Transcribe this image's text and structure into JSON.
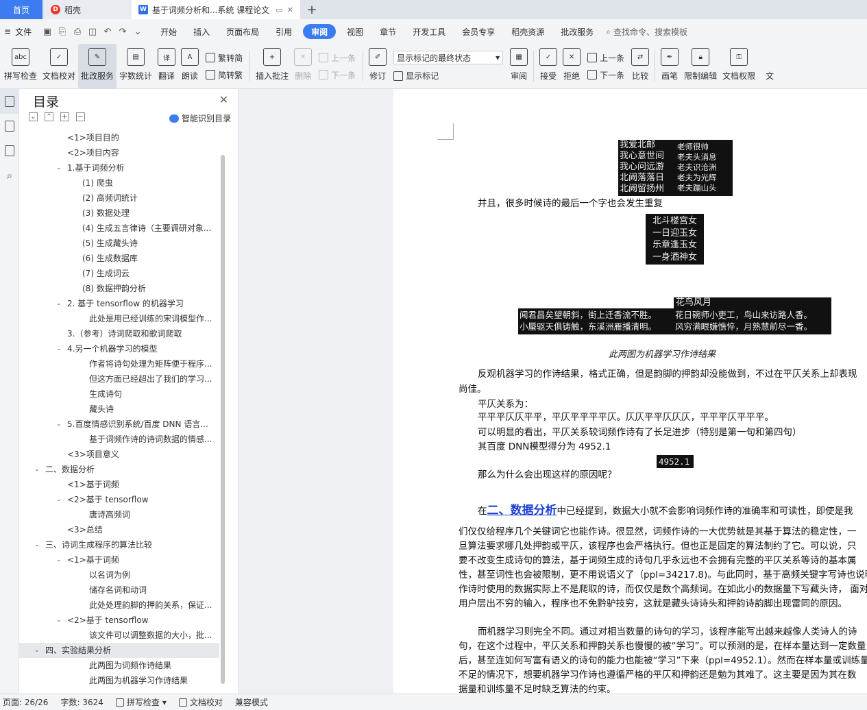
{
  "tabs": {
    "home": "首页",
    "docer": "稻壳",
    "doc": "基于词频分析和...系统 课程论文",
    "add": "+"
  },
  "menu": {
    "file": "文件",
    "tabs": [
      "开始",
      "插入",
      "页面布局",
      "引用",
      "审阅",
      "视图",
      "章节",
      "开发工具",
      "会员专享",
      "稻壳资源",
      "批改服务"
    ],
    "active_tab": "审阅",
    "search": "查找命令、搜索模板"
  },
  "ribbon": {
    "spell_check": "拼写检查",
    "doc_proof": "文档校对",
    "correction": "批改服务",
    "word_count": "字数统计",
    "translate": "翻译",
    "read_aloud": "朗读",
    "trad_to_simp": "繁转简",
    "simp_to_trad": "简转繁",
    "insert_comment": "插入批注",
    "delete": "删除",
    "prev_comment": "上一条",
    "next_comment": "下一条",
    "track": "修订",
    "markup_state": "显示标记的最终状态",
    "show_markup": "显示标记",
    "review": "审阅",
    "accept": "接受",
    "reject": "拒绝",
    "prev_change": "上一条",
    "next_change": "下一条",
    "compare": "比较",
    "pen": "画笔",
    "restrict": "限制编辑",
    "doc_rights": "文档权限",
    "more": "文"
  },
  "toc": {
    "title": "目录",
    "ai_label": "智能识别目录",
    "items": [
      {
        "label": "<1>项目目的",
        "lvl": 2,
        "car": ""
      },
      {
        "label": "<2>项目内容",
        "lvl": 2,
        "car": ""
      },
      {
        "label": "1.基于词频分析",
        "lvl": 2,
        "car": "v"
      },
      {
        "label": "(1) 爬虫",
        "lvl": 3,
        "car": ""
      },
      {
        "label": "(2) 高频词统计",
        "lvl": 3,
        "car": ""
      },
      {
        "label": "(3) 数据处理",
        "lvl": 3,
        "car": ""
      },
      {
        "label": "(4) 生成五言律诗（主要调研对象...",
        "lvl": 3,
        "car": ""
      },
      {
        "label": "(5) 生成藏头诗",
        "lvl": 3,
        "car": ""
      },
      {
        "label": "(6) 生成数据库",
        "lvl": 3,
        "car": ""
      },
      {
        "label": "(7) 生成词云",
        "lvl": 3,
        "car": ""
      },
      {
        "label": "(8) 数据押韵分析",
        "lvl": 3,
        "car": ""
      },
      {
        "label": "2. 基于 tensorflow 的机器学习",
        "lvl": 2,
        "car": "v"
      },
      {
        "label": "此处是用已经训练的宋词模型作...",
        "lvl": 4,
        "car": ""
      },
      {
        "label": "3.（参考）诗词爬取和歌词爬取",
        "lvl": 2,
        "car": ""
      },
      {
        "label": "4.另一个机器学习的模型",
        "lvl": 2,
        "car": "v"
      },
      {
        "label": "作者将诗句处理为矩阵便于程序...",
        "lvl": 4,
        "car": ""
      },
      {
        "label": "但这方面已经超出了我们的学习...",
        "lvl": 4,
        "car": ""
      },
      {
        "label": "生成诗句",
        "lvl": 4,
        "car": ""
      },
      {
        "label": "藏头诗",
        "lvl": 4,
        "car": ""
      },
      {
        "label": "5.百度情感识别系统/百度 DNN 语言...",
        "lvl": 2,
        "car": "v"
      },
      {
        "label": "基于词频作诗的诗词数据的情感...",
        "lvl": 4,
        "car": ""
      },
      {
        "label": "<3>项目意义",
        "lvl": 2,
        "car": ""
      },
      {
        "label": "二、数据分析",
        "lvl": 1,
        "car": "v"
      },
      {
        "label": "<1>基于词频",
        "lvl": 2,
        "car": ""
      },
      {
        "label": "<2>基于 tensorflow",
        "lvl": 2,
        "car": "v"
      },
      {
        "label": "唐诗高频词",
        "lvl": 4,
        "car": ""
      },
      {
        "label": "<3>总结",
        "lvl": 2,
        "car": ""
      },
      {
        "label": "三、诗词生成程序的算法比较",
        "lvl": 1,
        "car": "v"
      },
      {
        "label": "<1>基于词频",
        "lvl": 2,
        "car": "v"
      },
      {
        "label": "以名词为例",
        "lvl": 4,
        "car": ""
      },
      {
        "label": "储存名词和动词",
        "lvl": 4,
        "car": ""
      },
      {
        "label": "此处处理韵脚的押韵关系，保证...",
        "lvl": 4,
        "car": ""
      },
      {
        "label": "<2>基于 tensorflow",
        "lvl": 2,
        "car": "v"
      },
      {
        "label": "该文件可以调整数据的大小，批...",
        "lvl": 4,
        "car": ""
      },
      {
        "label": "四、实验结果分析",
        "lvl": 1,
        "car": "v",
        "selected": true
      },
      {
        "label": "此两图为词频作诗结果",
        "lvl": 4,
        "car": ""
      },
      {
        "label": "此两图为机器学习作诗结果",
        "lvl": 4,
        "car": ""
      }
    ]
  },
  "page": {
    "poem1_left": [
      "我爱北邮",
      "我心意世间",
      "我心问远游",
      "北阙落落日",
      "北阙留扬州"
    ],
    "poem1_right": [
      "老师很帅",
      "老夫头消息",
      "老夫识沧洲",
      "老夫为光辉",
      "老夫蹦山头"
    ],
    "repeat_note": "并且，很多时候诗的最后一个字也会发生重复",
    "poem2": [
      "北斗楼宫女",
      "一日迎玉女",
      "乐章逢玉女",
      "一身酒神女"
    ],
    "poem3_title": "花鸟风月",
    "poem3_left": [
      "闻君昌矣望朝斜，街上迁香流不胜。",
      "小蜃驱天俱铸触，东溪洲雁播清明。"
    ],
    "poem3_right": [
      "花日碗师小吏工，鸟山来访路人香。",
      "风穷满眼嫌憔悴，月熟慧前尽一香。"
    ],
    "caption": "此两图为机器学习作诗结果",
    "p1a": "反观机器学习的作诗结果，格式正确，但是韵脚的押韵却没能做到，不过在平仄关系上却表现",
    "p1b": "尚佳。",
    "p2": "平仄关系为：",
    "p3": "平平平仄仄平平，平仄平平平平仄。仄仄平平仄仄仄，平平平仄平平平。",
    "p4": "可以明显的看出，平仄关系较词频作诗有了长足进步（特别是第一句和第四句）",
    "p5": "其百度  DNN模型得分为  4952.1",
    "score": "4952.1",
    "p6": "那么为什么会出现这样的原因呢？",
    "p7_pre": "在",
    "p7_link": "二、数据分析",
    "p7_post": "中已经提到，数据大小就不会影响词频作诗的准确率和可读性，即使是我",
    "lines1": [
      "们仅仅给程序几个关键词它也能作诗。很显然，词频作诗的一大优势就是其基于算法的稳定性，一",
      "旦算法要求哪几处押韵或平仄，该程序也会严格执行。但也正是固定的算法制约了它。可以说，只",
      "要不改变生成诗句的算法，基于词频生成的诗句几乎永远也不会拥有完整的平仄关系等诗的基本属",
      "性，甚至词性也会被限制，更不用说语义了（ppl=34217.8)。与此同时，基于高频关键字写诗也说明了",
      "作诗时使用的数据实际上不是爬取的诗，而仅仅是数个高频词。在如此小的数据量下写藏头诗，  面对",
      "用户层出不穷的输入，程序也不免黔驴技穷，这就是藏头诗诗头和押韵诗韵脚出现雷同的原因。"
    ],
    "lines2": [
      "而机器学习则完全不同。通过对相当数量的诗句的学习，该程序能写出越来越像人类诗人的诗",
      "句，在这个过程中，平仄关系和押韵关系也慢慢的被“学习”。可以预测的是，在样本量达到一定数量以",
      "后，甚至连如何写富有语义的诗句的能力也能被“学习”下来（ppl=4952.1）。然而在样本量或训练量",
      "不足的情况下，想要机器学习作诗也遵循严格的平仄和押韵还是勉为其难了。这主要是因为其在数",
      "据量和训练量不足时缺乏算法的约束。"
    ]
  },
  "status": {
    "page": "页面: 26/26",
    "words": "字数: 3624",
    "spell": "拼写检查",
    "proof": "文档校对",
    "compat": "兼容模式"
  }
}
